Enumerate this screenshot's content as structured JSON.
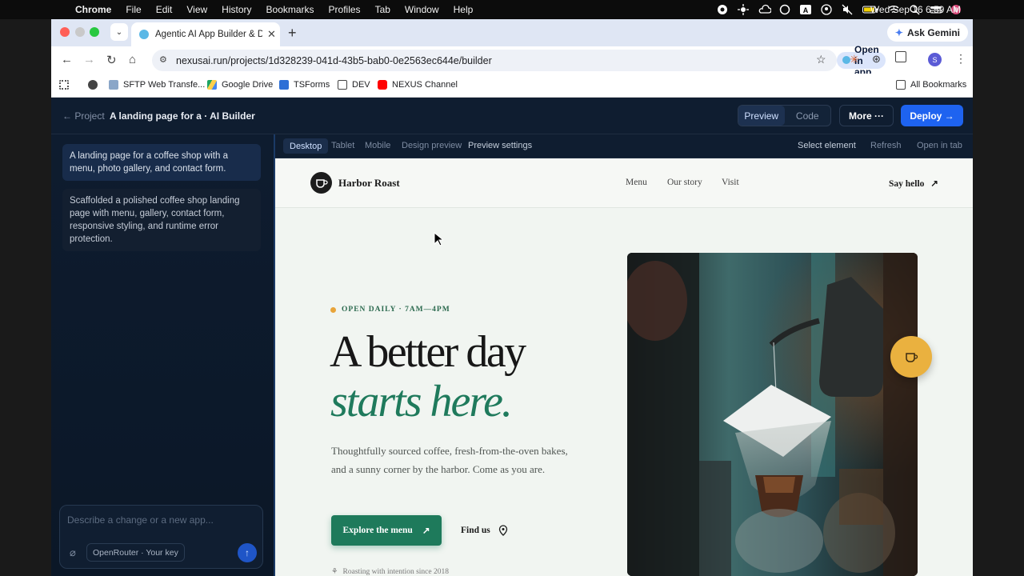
{
  "os_menubar": {
    "app_name": "Chrome",
    "menus": [
      "File",
      "Edit",
      "View",
      "History",
      "Bookmarks",
      "Profiles",
      "Tab",
      "Window",
      "Help"
    ],
    "datetime": "Wed Sep 16  6:59 AM"
  },
  "browser": {
    "tab_title": "Agentic AI App Builder & Dep",
    "ask_gemini": "Ask Gemini",
    "url": "nexusai.run/projects/1d328239-041d-43b5-bab0-0e2563ec644e/builder",
    "open_in_app": "Open in app",
    "profile_initial": "S",
    "bookmarks": [
      "SFTP Web Transfe...",
      "Google Drive",
      "TSForms",
      "DEV",
      "NEXUS Channel"
    ],
    "all_bookmarks": "All Bookmarks"
  },
  "app": {
    "back_label": "← Project",
    "project_title": "A landing page for a · AI Builder",
    "view_toggle": {
      "preview": "Preview",
      "code": "Code",
      "active": "preview"
    },
    "more_label": "More ···",
    "deploy_label": "Deploy →"
  },
  "chat": {
    "user_message": "A landing page for a coffee shop with a menu, photo gallery, and contact form.",
    "ai_message": "Scaffolded a polished coffee shop landing page with menu, gallery, contact form, responsive styling, and runtime error protection.",
    "input_placeholder": "Describe a change or a new app...",
    "model_chip": "OpenRouter · Your key"
  },
  "preview_toolbar": {
    "devices": [
      "Desktop",
      "Tablet",
      "Mobile"
    ],
    "active_device": "Desktop",
    "design_preview": "Design preview",
    "preview_settings": "Preview settings",
    "select_element": "Select element",
    "refresh": "Refresh",
    "open_in_tab": "Open in tab"
  },
  "site": {
    "brand": "Harbor Roast",
    "nav": [
      "Menu",
      "Our story",
      "Visit"
    ],
    "cta_nav": "Say hello",
    "badge": "OPEN DAILY · 7AM—4PM",
    "headline_1": "A better day",
    "headline_2": "starts here.",
    "lede": "Thoughtfully sourced coffee, fresh-from-the-oven bakes, and a sunny corner by the harbor. Come as you are.",
    "primary_cta": "Explore the menu",
    "secondary_cta": "Find us",
    "footnote": "Roasting with intention since 2018",
    "accent_color": "#1f7a5c",
    "badge_dot_color": "#e8a43a"
  }
}
